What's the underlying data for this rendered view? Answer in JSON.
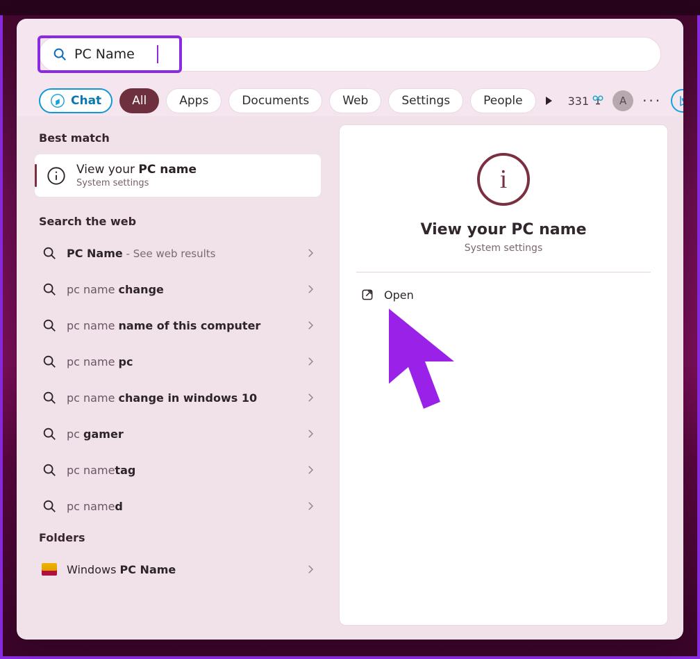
{
  "search": {
    "value": "PC Name"
  },
  "filters": {
    "chat": "Chat",
    "all": "All",
    "apps": "Apps",
    "documents": "Documents",
    "web": "Web",
    "settings": "Settings",
    "people": "People"
  },
  "header": {
    "count": "331",
    "avatar_initial": "A"
  },
  "left": {
    "best_match_heading": "Best match",
    "best_match": {
      "title_pre": "View your ",
      "title_bold": "PC name",
      "subtitle": "System settings"
    },
    "search_web_heading": "Search the web",
    "web": [
      {
        "pre": "",
        "bold": "PC Name",
        "post": "",
        "suffix": " - See web results"
      },
      {
        "pre": "pc name ",
        "bold": "change",
        "post": ""
      },
      {
        "pre": "pc name ",
        "bold": "name of this computer",
        "post": ""
      },
      {
        "pre": "pc name ",
        "bold": "pc",
        "post": ""
      },
      {
        "pre": "pc name ",
        "bold": "change in windows 10",
        "post": ""
      },
      {
        "pre": "pc ",
        "bold": "gamer",
        "post": ""
      },
      {
        "pre": "pc name",
        "bold": "tag",
        "post": ""
      },
      {
        "pre": "pc name",
        "bold": "d",
        "post": ""
      }
    ],
    "folders_heading": "Folders",
    "folder": {
      "pre": "Windows ",
      "bold": "PC Name"
    }
  },
  "right": {
    "title": "View your PC name",
    "subtitle": "System settings",
    "open": "Open"
  }
}
